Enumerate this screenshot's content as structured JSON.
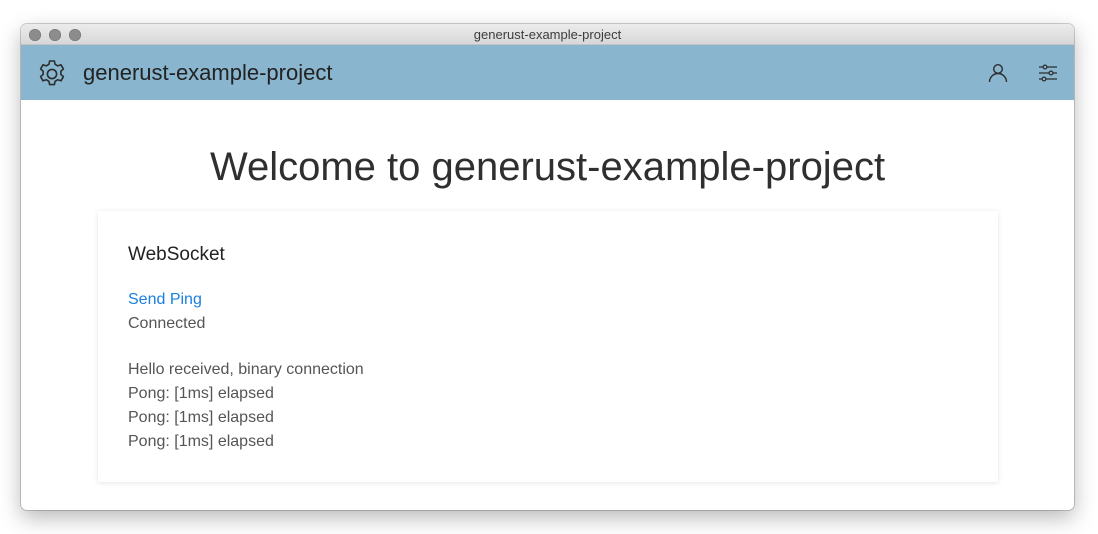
{
  "window": {
    "title": "generust-example-project"
  },
  "appbar": {
    "app_name": "generust-example-project",
    "logo_icon": "gear-icon",
    "user_icon": "user-icon",
    "settings_icon": "sliders-icon",
    "background_color": "#89b5ce"
  },
  "main": {
    "heading": "Welcome to generust-example-project"
  },
  "websocket_card": {
    "title": "WebSocket",
    "send_ping_label": "Send Ping",
    "status": "Connected",
    "log": [
      "Hello received, binary connection",
      "Pong: [1ms] elapsed",
      "Pong: [1ms] elapsed",
      "Pong: [1ms] elapsed"
    ]
  },
  "colors": {
    "link": "#1a7fe0",
    "text": "#555555"
  }
}
